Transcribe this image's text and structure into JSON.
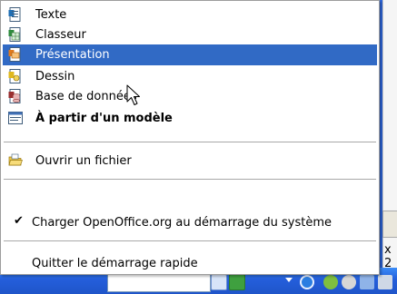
{
  "menu": {
    "items": [
      {
        "label": "Texte",
        "icon": "writer-document-icon",
        "highlighted": false,
        "bold": false
      },
      {
        "label": "Classeur",
        "icon": "calc-spreadsheet-icon",
        "highlighted": false,
        "bold": false
      },
      {
        "label": "Présentation",
        "icon": "impress-presentation-icon",
        "highlighted": true,
        "bold": false
      },
      {
        "label": "Dessin",
        "icon": "draw-drawing-icon",
        "highlighted": false,
        "bold": false
      },
      {
        "label": "Base de données",
        "icon": "base-database-icon",
        "highlighted": false,
        "bold": false
      },
      {
        "label": "À partir d'un modèle",
        "icon": "template-icon",
        "highlighted": false,
        "bold": true
      }
    ],
    "open_file_label": "Ouvrir un fichier",
    "startup_label": "Charger OpenOffice.org au démarrage du système",
    "startup_checked": true,
    "check_glyph": "✔",
    "quit_label": "Quitter le démarrage rapide"
  },
  "background": {
    "tab_text": "x 2"
  },
  "colors": {
    "highlight": "#316ac5",
    "taskbar": "#245edb"
  }
}
